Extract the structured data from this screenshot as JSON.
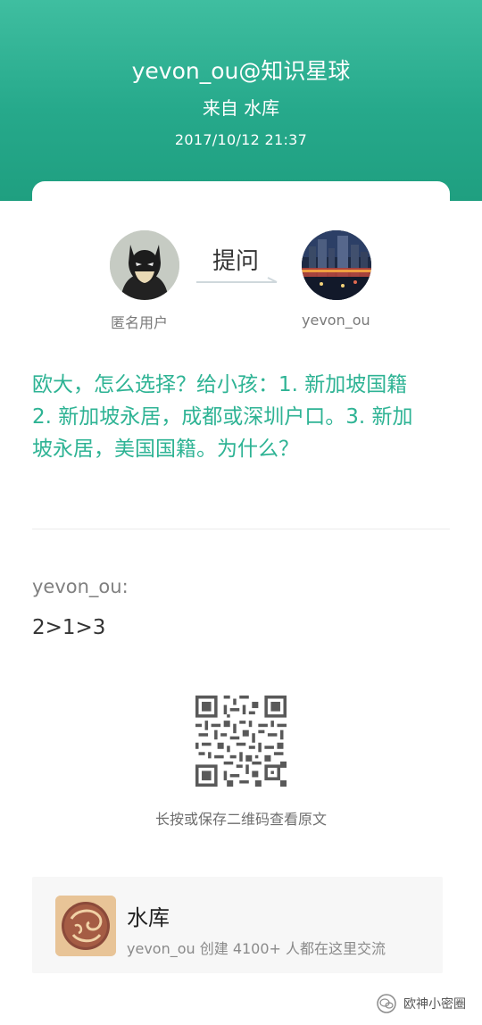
{
  "header": {
    "author": "yevon_ou@知识星球",
    "source": "来自 水库",
    "date": "2017/10/12 21:37"
  },
  "exchange": {
    "asker_name": "匿名用户",
    "action": "提问",
    "answerer_name": "yevon_ou",
    "asker_avatar_icon": "batman-avatar-icon",
    "answerer_avatar_icon": "city-night-avatar-icon"
  },
  "question": {
    "lines": [
      "欧大，怎么选择？给小孩：1. 新加坡国籍",
      "2. 新加坡永居，成都或深圳户口。3. 新加",
      "坡永居，美国国籍。为什么？"
    ]
  },
  "answer": {
    "author": "yevon_ou:",
    "text": "2>1>3"
  },
  "qr": {
    "hint": "长按或保存二维码查看原文"
  },
  "group": {
    "name": "水库",
    "description": "yevon_ou 创建 4100+ 人都在这里交流"
  },
  "watermark": {
    "text": "欧神小密圈"
  },
  "colors": {
    "header_start": "#3fbea0",
    "header_end": "#1f9f80",
    "question_text": "#2eb394"
  }
}
